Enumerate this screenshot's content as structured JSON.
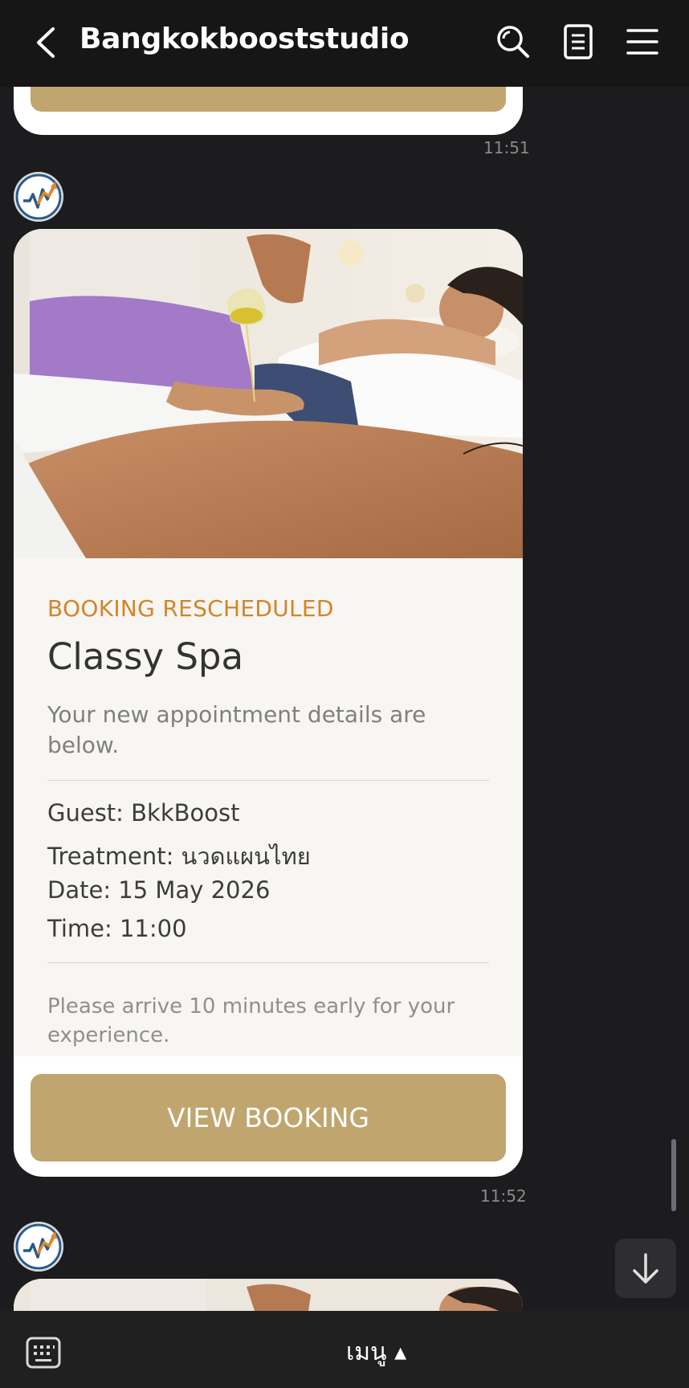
{
  "header": {
    "title": "Bangkokbooststudio",
    "icons": [
      "back-arrow-icon",
      "search-icon",
      "notes-icon",
      "hamburger-menu-icon"
    ]
  },
  "messages": [
    {
      "time": "11:51"
    },
    {
      "time": "11:52",
      "card": {
        "status": "BOOKING RESCHEDULED",
        "title": "Classy Spa",
        "subtitle": "Your new appointment details are below.",
        "guest": "Guest: BkkBoost",
        "treatment": "Treatment: นวดแผนไทย",
        "date": "Date: 15 May 2026",
        "time": "Time: 11:00",
        "note": "Please arrive 10 minutes early for your experience.",
        "button": "VIEW BOOKING"
      }
    }
  ],
  "footer": {
    "menu_label": "เมนู ▴"
  },
  "colors": {
    "background": "#1c1c1e",
    "gold": "#c0a56e",
    "status_orange": "#d2852a"
  }
}
